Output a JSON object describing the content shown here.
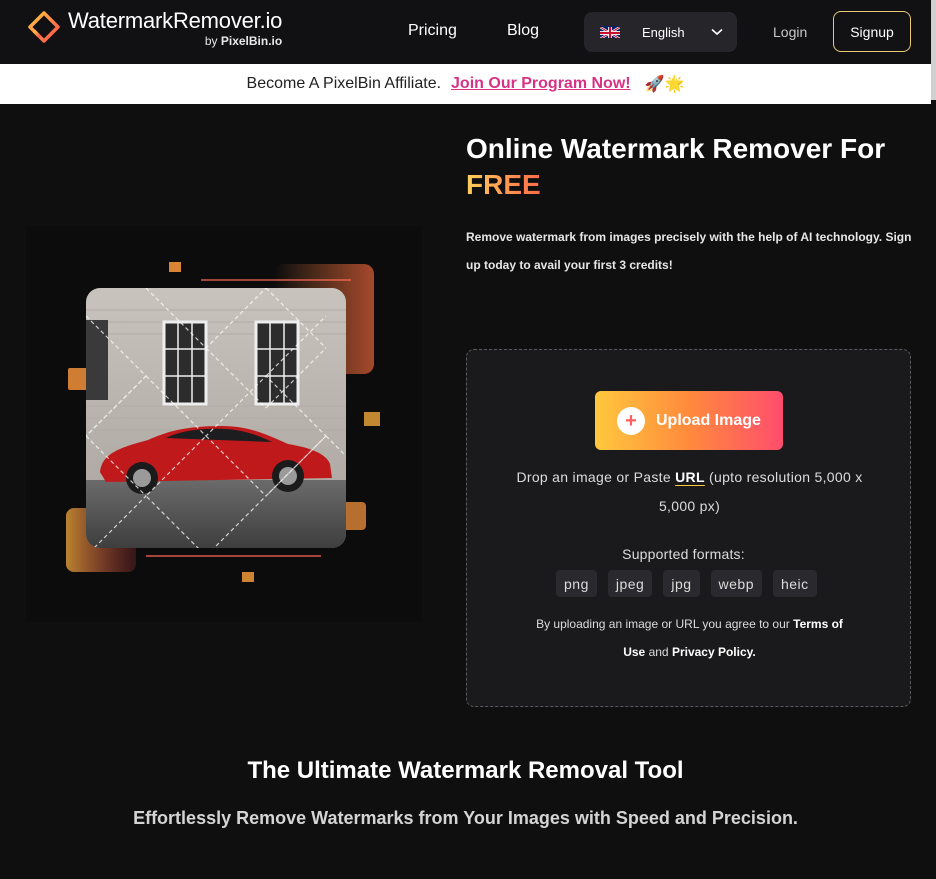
{
  "header": {
    "logo_title": "WatermarkRemover.io",
    "logo_by": "by",
    "logo_brand": "PixelBin.io",
    "nav": {
      "pricing": "Pricing",
      "blog": "Blog"
    },
    "language": {
      "selected": "English",
      "flag": "uk-flag-icon"
    },
    "login": "Login",
    "signup": "Signup"
  },
  "banner": {
    "text": "Become A PixelBin Affiliate.",
    "link": "Join Our Program Now!",
    "emoji": "🚀🌟"
  },
  "hero": {
    "title": "Online Watermark Remover For",
    "title_highlight": "FREE",
    "description": "Remove watermark from images precisely with the help of AI technology. Sign up today to avail your first 3 credits!"
  },
  "upload": {
    "button_label": "Upload Image",
    "drop_prefix": "Drop an image or Paste",
    "drop_url": "URL",
    "drop_suffix": "(upto resolution 5,000 x 5,000 px)",
    "formats_label": "Supported formats:",
    "formats": [
      "png",
      "jpeg",
      "jpg",
      "webp",
      "heic"
    ],
    "terms_prefix": "By uploading an image or URL you agree to our",
    "terms_link": "Terms of Use",
    "terms_and": "and",
    "privacy_link": "Privacy Policy."
  },
  "section": {
    "title": "The Ultimate Watermark Removal Tool",
    "subtitle": "Effortlessly Remove Watermarks from Your Images with Speed and Precision."
  },
  "colors": {
    "accent_yellow": "#ffc83d",
    "accent_pink": "#d63384",
    "gradient_end": "#ff4d6d",
    "background": "#0f0f10"
  }
}
